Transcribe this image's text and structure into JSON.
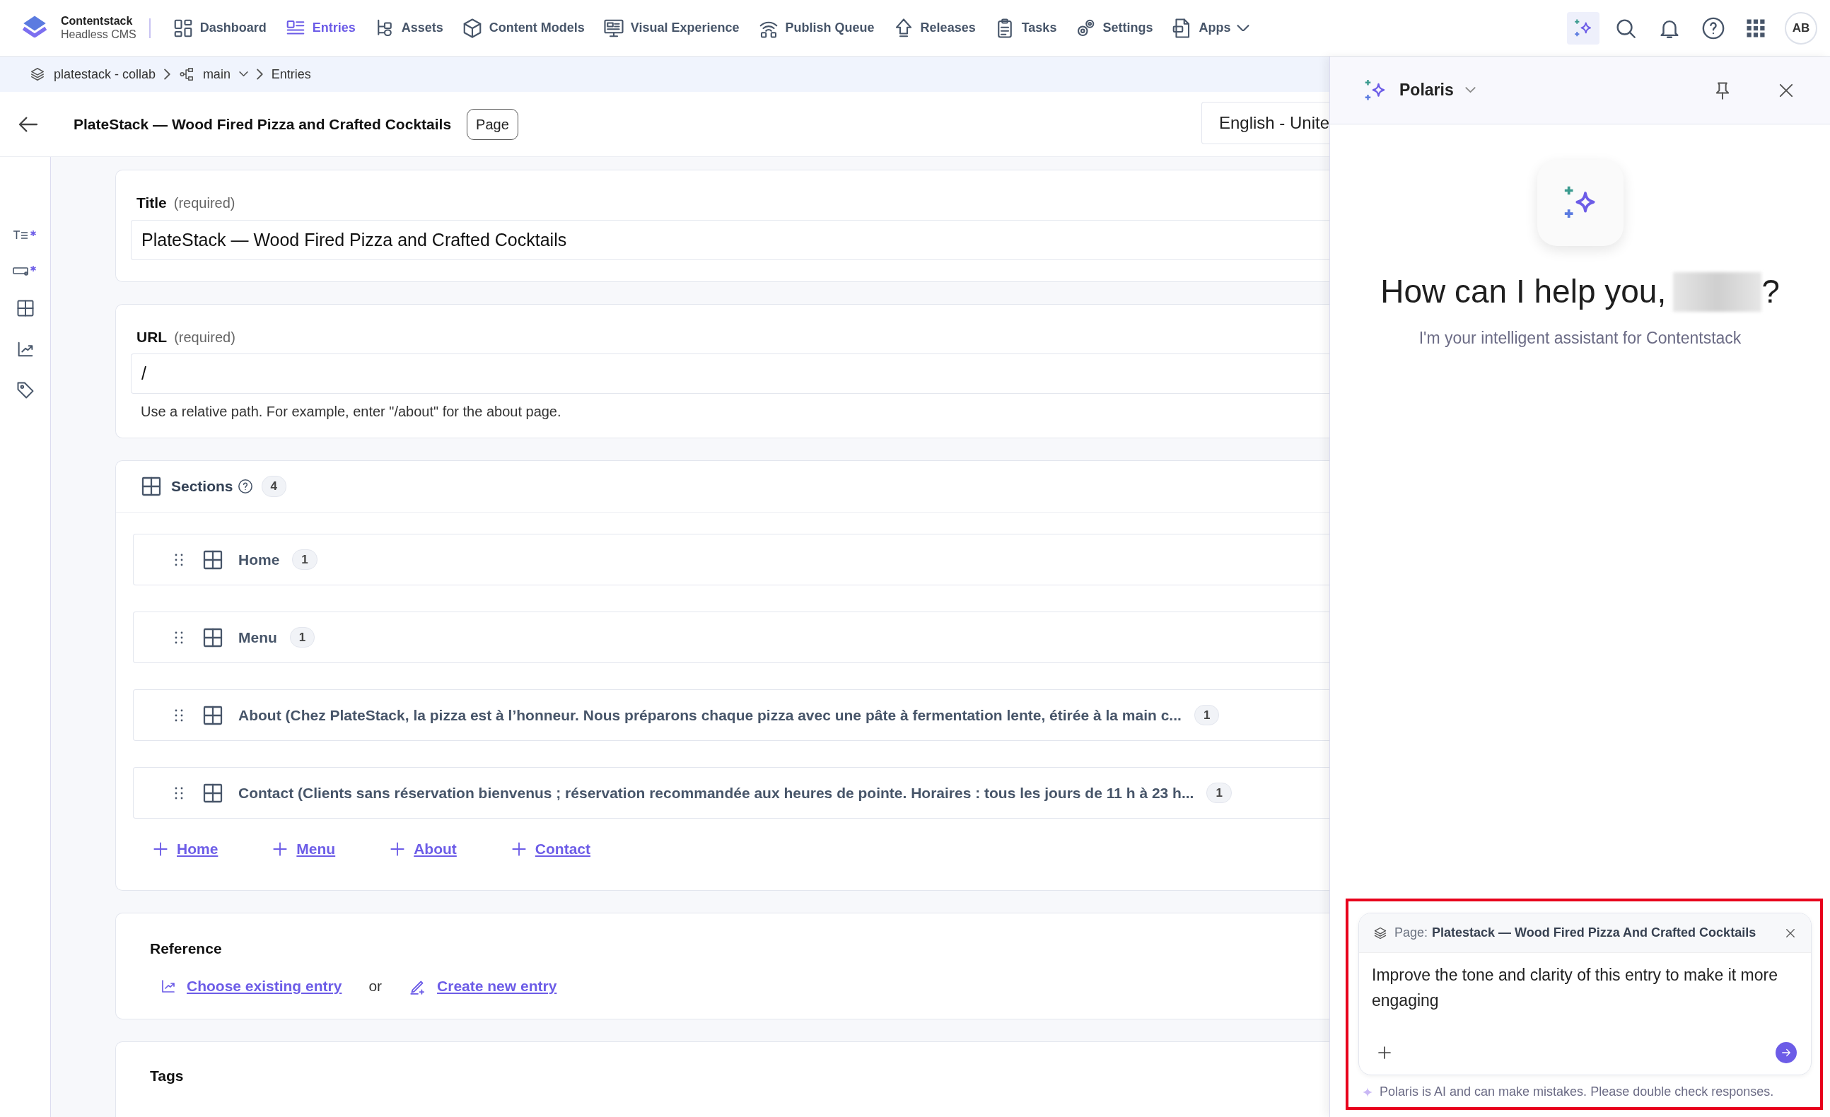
{
  "app": {
    "name": "Contentstack",
    "subtitle": "Headless CMS"
  },
  "nav": [
    {
      "label": "Dashboard",
      "selected": false
    },
    {
      "label": "Entries",
      "selected": true
    },
    {
      "label": "Assets",
      "selected": false
    },
    {
      "label": "Content Models",
      "selected": false
    },
    {
      "label": "Visual Experience",
      "selected": false
    },
    {
      "label": "Publish Queue",
      "selected": false
    },
    {
      "label": "Releases",
      "selected": false
    },
    {
      "label": "Tasks",
      "selected": false
    },
    {
      "label": "Settings",
      "selected": false
    },
    {
      "label": "Apps",
      "selected": false
    }
  ],
  "user": {
    "initials": "AB"
  },
  "breadcrumb": [
    "platestack - collab",
    "main",
    "Entries"
  ],
  "entry": {
    "title": "PlateStack — Wood Fired Pizza and Crafted Cocktails",
    "content_type": "Page",
    "locale": "English - Unite"
  },
  "title_field": {
    "label": "Title",
    "note": "(required)",
    "value": "PlateStack — Wood Fired Pizza and Crafted Cocktails"
  },
  "url_field": {
    "label": "URL",
    "note": "(required)",
    "value": "/",
    "help": "Use a relative path. For example, enter \"/about\" for the about page."
  },
  "sections": {
    "label": "Sections",
    "count": "4",
    "items": [
      {
        "title": "Home",
        "count": "1"
      },
      {
        "title": "Menu",
        "count": "1"
      },
      {
        "title": "About (Chez PlateStack, la pizza est à l’honneur. Nous préparons chaque pizza avec une pâte à fermentation lente, étirée à la main c...",
        "count": "1"
      },
      {
        "title": "Contact (Clients sans réservation bienvenus ; réservation recommandée aux heures de pointe. Horaires : tous les jours de 11 h à 23 h...",
        "count": "1"
      }
    ],
    "add_links": [
      "Home",
      "Menu",
      "About",
      "Contact"
    ]
  },
  "reference": {
    "label": "Reference",
    "choose": "Choose existing entry",
    "or": "or",
    "create": "Create new entry"
  },
  "tags": {
    "label": "Tags"
  },
  "assistant": {
    "title": "Polaris",
    "greeting": "How can I help you,",
    "greeting_end": "?",
    "subtitle": "I'm your intelligent assistant for Contentstack",
    "context_prefix": "Page:",
    "context_name": "Platestack — Wood Fired Pizza And Crafted Cocktails",
    "prompt": "Improve the tone and clarity of this entry to make it more engaging",
    "disclaimer": "Polaris is AI and can make mistakes. Please double check responses.",
    "highlighted": true
  }
}
